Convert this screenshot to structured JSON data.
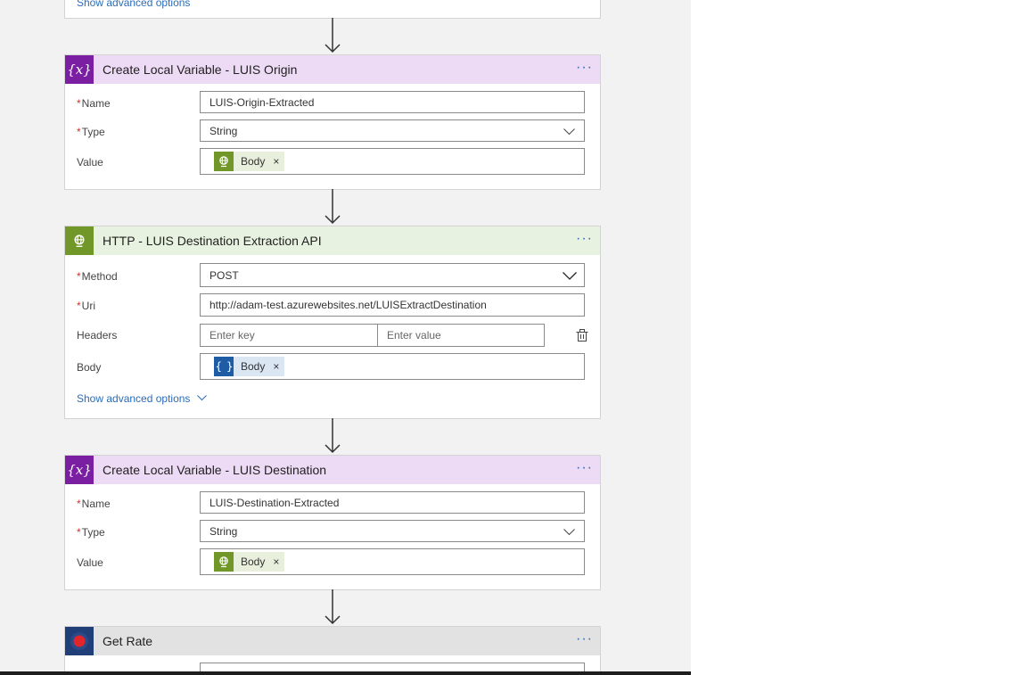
{
  "cards": [
    {
      "title": "Create Local Variable - LUIS Origin",
      "fields": {
        "name_label": "Name",
        "name_value": "LUIS-Origin-Extracted",
        "type_label": "Type",
        "type_value": "String",
        "value_label": "Value",
        "value_token": "Body"
      }
    },
    {
      "title": "HTTP - LUIS Destination Extraction API",
      "fields": {
        "method_label": "Method",
        "method_value": "POST",
        "uri_label": "Uri",
        "uri_value": "http://adam-test.azurewebsites.net/LUISExtractDestination",
        "headers_label": "Headers",
        "headers_key_placeholder": "Enter key",
        "headers_value_placeholder": "Enter value",
        "body_label": "Body",
        "body_token": "Body"
      },
      "advanced_label": "Show advanced options"
    },
    {
      "title": "Create Local Variable - LUIS Destination",
      "fields": {
        "name_label": "Name",
        "name_value": "LUIS-Destination-Extracted",
        "type_label": "Type",
        "type_value": "String",
        "value_label": "Value",
        "value_token": "Body"
      }
    },
    {
      "title": "Get Rate"
    }
  ],
  "top_card": {
    "advanced_label": "Show advanced options"
  },
  "required_marker": "*",
  "token_remove_glyph": "×",
  "more_glyph": "···",
  "icons": {
    "variable": "variable-icon",
    "http": "globe-icon",
    "json": "braces-icon",
    "rate": "target-icon",
    "chevron": "chevron-down-icon",
    "delete": "delete-icon",
    "arrow": "arrow-down-icon"
  },
  "colors": {
    "variable_header": "#eddaf5",
    "variable_icon": "#7a1fa2",
    "http_header": "#e8f2e0",
    "http_icon": "#709727",
    "json_icon": "#1f5ca6",
    "rate_header": "#e2e2e2",
    "link": "#2b6cb8",
    "required": "#d0342c"
  }
}
